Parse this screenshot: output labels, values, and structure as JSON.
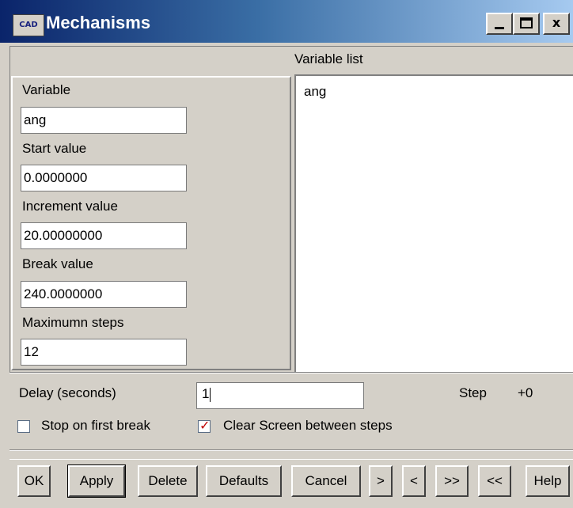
{
  "window": {
    "title": "Mechanisms",
    "icon_label": "CAD",
    "controls": {
      "minimize": "_",
      "maximize": "□",
      "close": "x"
    }
  },
  "variable_list": {
    "label": "Variable list",
    "items": [
      "ang"
    ]
  },
  "fields": {
    "variable": {
      "label": "Variable",
      "value": "ang"
    },
    "start": {
      "label": "Start value",
      "value": "0.0000000"
    },
    "increment": {
      "label": "Increment value",
      "value": "20.00000000"
    },
    "break": {
      "label": "Break value",
      "value": "240.0000000"
    },
    "max_steps": {
      "label": "Maximumn steps",
      "value": "12"
    }
  },
  "delay": {
    "label": "Delay (seconds)",
    "value": "1"
  },
  "step": {
    "label": "Step",
    "value": "+0"
  },
  "checkboxes": {
    "stop_on_first_break": {
      "label": "Stop on first break",
      "checked": false
    },
    "clear_screen": {
      "label": "Clear Screen between steps",
      "checked": true,
      "mark": "✓"
    }
  },
  "buttons": {
    "ok": "OK",
    "apply": "Apply",
    "delete": "Delete",
    "defaults": "Defaults",
    "cancel": "Cancel",
    "next": ">",
    "prev": "<",
    "last": ">>",
    "first": "<<",
    "help": "Help"
  },
  "colors": {
    "titlebar_start": "#0a246a",
    "titlebar_end": "#a6caf0",
    "dialog_face": "#d4d0c8",
    "check_mark": "#c00000"
  }
}
